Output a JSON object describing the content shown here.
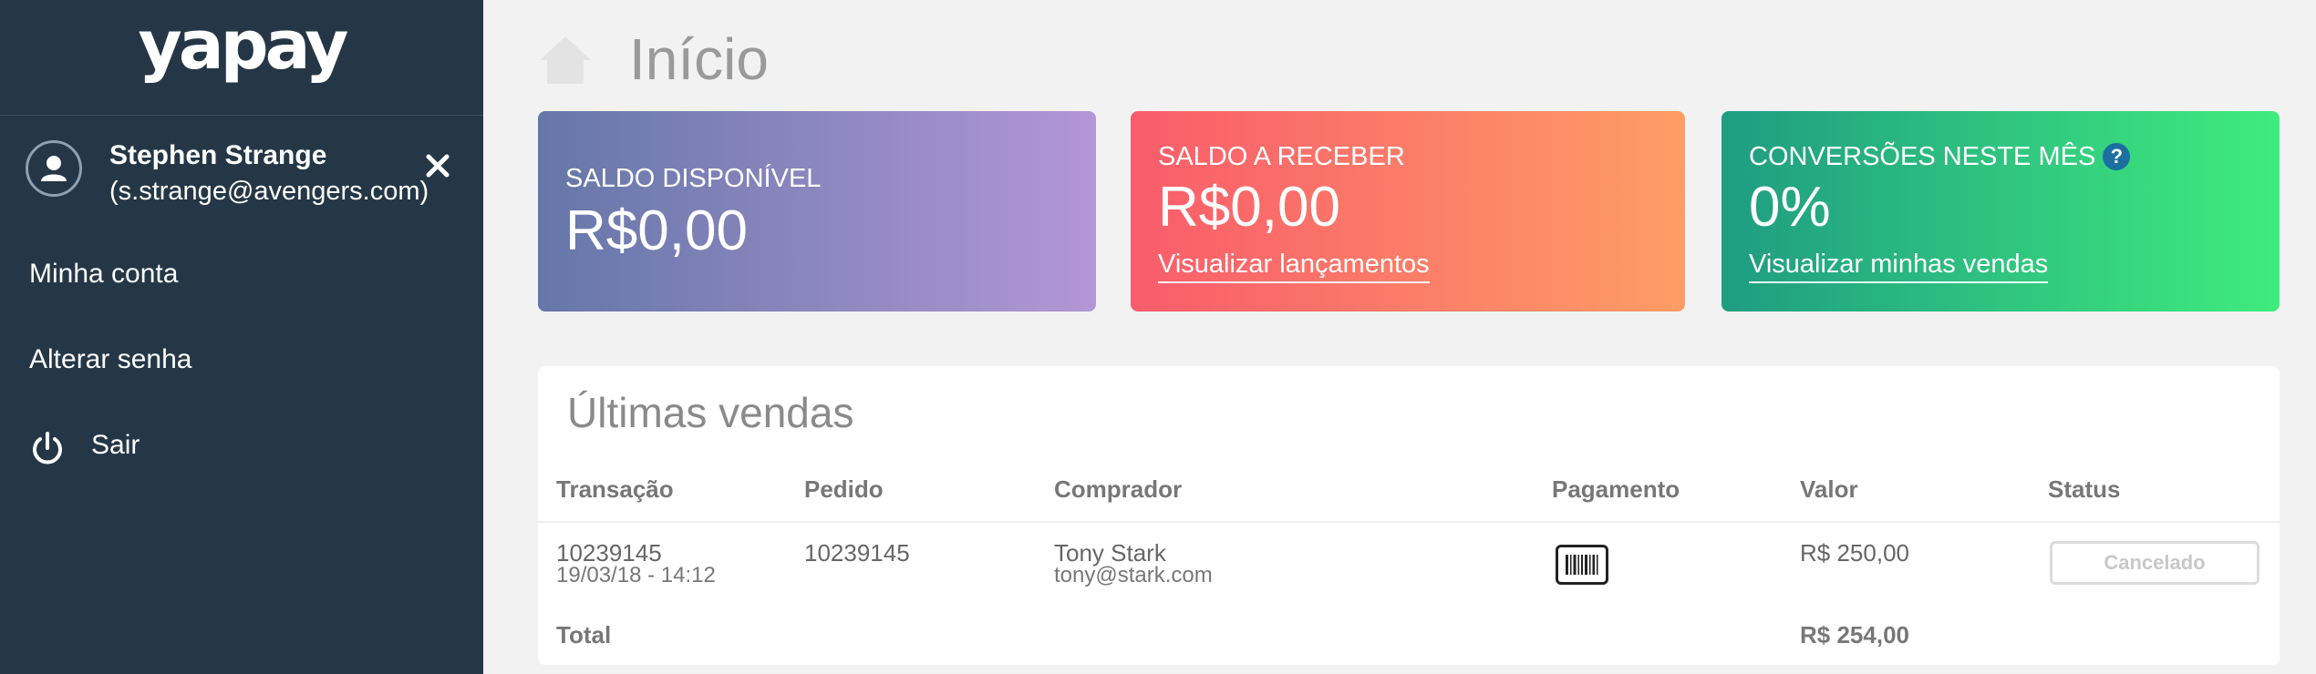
{
  "sidebar": {
    "logo": "yapay",
    "user": {
      "name": "Stephen Strange",
      "email": "(s.strange@avengers.com)"
    },
    "links": {
      "account": "Minha conta",
      "password": "Alterar senha",
      "logout": "Sair"
    }
  },
  "main": {
    "title": "Início",
    "cards": {
      "available": {
        "label": "SALDO DISPONÍVEL",
        "value": "R$0,00"
      },
      "receivable": {
        "label": "SALDO A RECEBER",
        "value": "R$0,00",
        "link": "Visualizar lançamentos"
      },
      "conversions": {
        "label": "CONVERSÕES NESTE MÊS",
        "help": "?",
        "value": "0%",
        "link": "Visualizar minhas vendas"
      }
    },
    "sales": {
      "title": "Últimas vendas",
      "columns": [
        "Transação",
        "Pedido",
        "Comprador",
        "Pagamento",
        "Valor",
        "Status"
      ],
      "rows": [
        {
          "transaction": "10239145",
          "datetime": "19/03/18 - 14:12",
          "order": "10239145",
          "buyer_name": "Tony Stark",
          "buyer_email": "tony@stark.com",
          "payment_icon": "barcode-icon",
          "value": "R$ 250,00",
          "status": "Cancelado"
        }
      ],
      "total_label": "Total",
      "total_value": "R$ 254,00"
    }
  }
}
